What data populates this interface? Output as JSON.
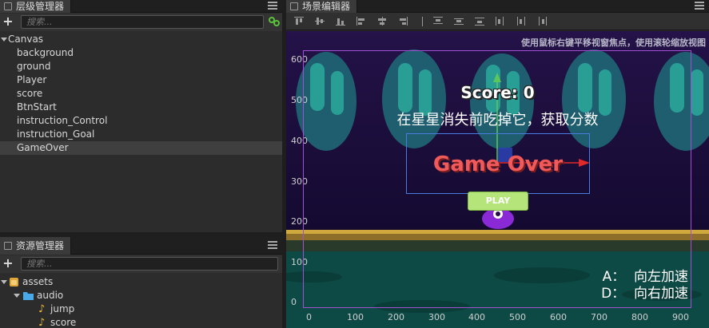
{
  "hierarchy": {
    "title": "层级管理器",
    "search_placeholder": "搜索...",
    "root": "Canvas",
    "children": [
      "background",
      "ground",
      "Player",
      "score",
      "BtnStart",
      "instruction_Control",
      "instruction_Goal",
      "GameOver"
    ],
    "selected": "GameOver"
  },
  "assets": {
    "title": "资源管理器",
    "search_placeholder": "搜索...",
    "root": "assets",
    "folder": "audio",
    "files": [
      "jump",
      "score"
    ]
  },
  "scene": {
    "title": "场景编辑器",
    "hint": "使用鼠标右键平移视窗焦点，使用滚轮缩放视图",
    "y_ticks": [
      "600",
      "500",
      "400",
      "300",
      "200",
      "100",
      "0"
    ],
    "x_ticks": [
      "0",
      "100",
      "200",
      "300",
      "400",
      "500",
      "600",
      "700",
      "800",
      "900"
    ],
    "score_text": "Score: 0",
    "instruction_goal": "在星星消失前吃掉它，获取分数",
    "game_over_text": "Game Over",
    "play_label": "PLAY",
    "control_line1": "A：  向左加速",
    "control_line2": "D：  向右加速"
  },
  "colors": {
    "sky": "#1b0d3a",
    "ground_stripe": "#c7a13a",
    "ground": "#0e4a45",
    "accent_purple": "#a24fd1",
    "selection_blue": "#4a7be0",
    "game_over": "#f05a5a",
    "play_button": "#b5e57a"
  }
}
